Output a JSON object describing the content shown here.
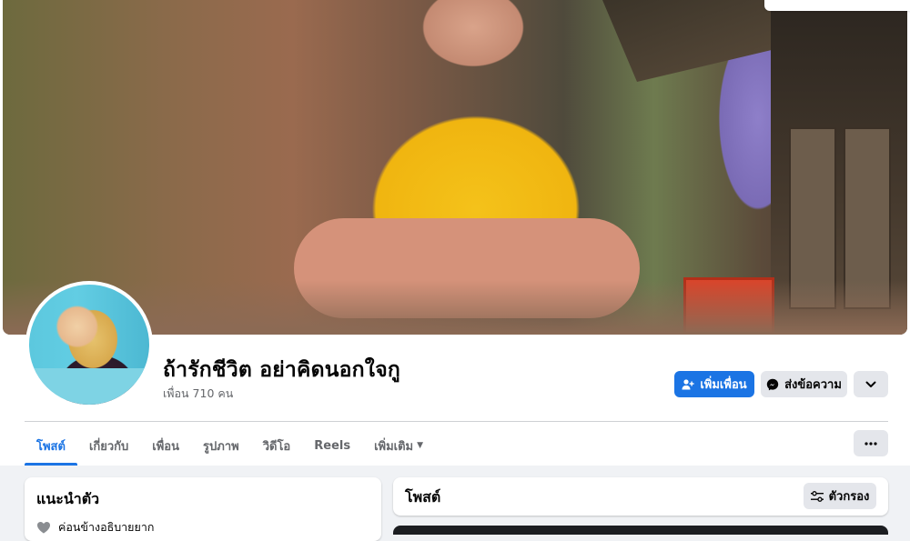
{
  "profile": {
    "name": "ถ้ารักชีวิต อย่าคิดนอกใจกู",
    "friends_count": "เพื่อน 710 คน"
  },
  "actions": {
    "add_friend": "เพิ่มเพื่อน",
    "message": "ส่งข้อความ"
  },
  "tabs": [
    {
      "label": "โพสต์",
      "active": true
    },
    {
      "label": "เกี่ยวกับ"
    },
    {
      "label": "เพื่อน"
    },
    {
      "label": "รูปภาพ"
    },
    {
      "label": "วิดีโอ"
    },
    {
      "label": "Reels"
    },
    {
      "label": "เพิ่มเติม"
    }
  ],
  "intro": {
    "title": "แนะนำตัว",
    "relationship": "ค่อนข้างอธิบายยาก"
  },
  "posts": {
    "title": "โพสต์",
    "filter_label": "ตัวกรอง"
  },
  "colors": {
    "accent": "#1b74e4",
    "secondary_button": "#e4e6eb",
    "page_background": "#f0f2f5"
  },
  "icons": {
    "add_friend": "person-plus-icon",
    "message": "messenger-icon",
    "chevron": "chevron-down-icon",
    "more": "ellipsis-icon",
    "filter": "sliders-icon",
    "relationship": "heart-icon"
  }
}
